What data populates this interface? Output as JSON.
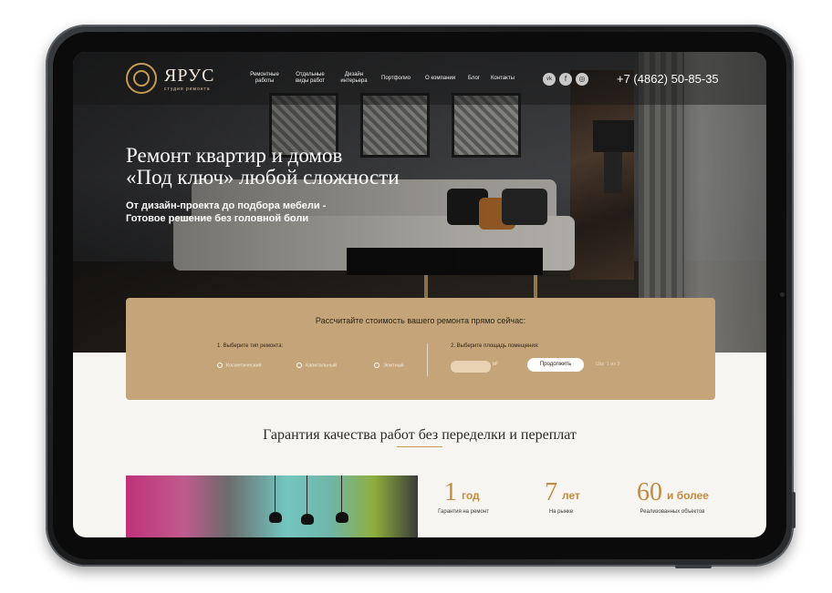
{
  "brand": {
    "name": "ЯРУС",
    "subtitle": "студия ремонта"
  },
  "nav": [
    {
      "label": "Ремонтные работы"
    },
    {
      "label": "Отдельные виды работ"
    },
    {
      "label": "Дизайн интерьера"
    },
    {
      "label": "Портфолио"
    },
    {
      "label": "О компании"
    },
    {
      "label": "Блог"
    },
    {
      "label": "Контакты"
    }
  ],
  "social": [
    {
      "name": "vk-icon",
      "glyph": "vk"
    },
    {
      "name": "facebook-icon",
      "glyph": "f"
    },
    {
      "name": "instagram-icon",
      "glyph": "◎"
    }
  ],
  "phone": "+7 (4862) 50-85-35",
  "hero": {
    "title_line1": "Ремонт квартир и домов",
    "title_line2": "«Под ключ» любой сложности",
    "subtitle_line1": "От дизайн-проекта до подбора мебели -",
    "subtitle_line2": "Готовое решение без головной боли"
  },
  "calculator": {
    "title": "Рассчитайте стоимость вашего ремонта прямо сейчас:",
    "step1_label": "1. Выберите тип ремонта:",
    "options": [
      "Косметический",
      "Капитальный",
      "Элитный"
    ],
    "step2_label": "2. Выберите площадь помещения:",
    "area_value": "",
    "unit": "м²",
    "continue_label": "Продолжить",
    "step_info": "Шаг 1 из 3"
  },
  "guarantee": {
    "title": "Гарантия качества работ без переделки и переплат",
    "stats": [
      {
        "num": "1",
        "unit": "год",
        "label": "Гарантия на ремонт"
      },
      {
        "num": "7",
        "unit": "лет",
        "label": "На рынке"
      },
      {
        "num": "60",
        "unit": "и более",
        "label": "Реализованных объектов"
      }
    ]
  },
  "colors": {
    "accent": "#c6a47a",
    "gold": "#c79a54",
    "stat": "#c48a3f"
  }
}
